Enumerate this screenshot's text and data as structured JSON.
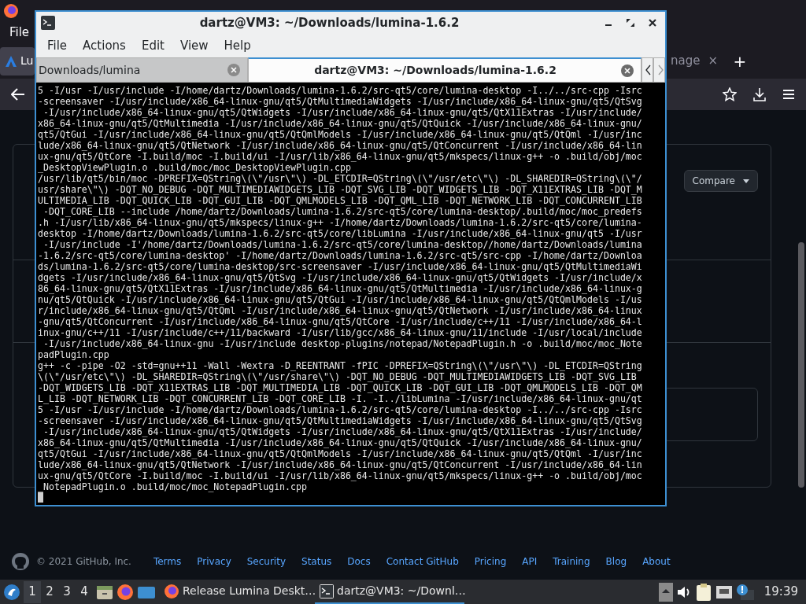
{
  "browser": {
    "menu": [
      "File"
    ],
    "tabs": [
      {
        "label": "Lu"
      },
      {
        "label": "nage"
      }
    ],
    "tab_close": "×",
    "new_tab": "+",
    "page": {
      "compare_button": "Compare",
      "footer": {
        "copyright": "© 2021 GitHub, Inc.",
        "links": [
          "Terms",
          "Privacy",
          "Security",
          "Status",
          "Docs",
          "Contact GitHub",
          "Pricing",
          "API",
          "Training",
          "Blog",
          "About"
        ]
      }
    }
  },
  "terminal": {
    "title": "dartz@VM3: ~/Downloads/lumina-1.6.2",
    "menu": [
      "File",
      "Actions",
      "Edit",
      "View",
      "Help"
    ],
    "tabs": [
      {
        "label": "Downloads/lumina",
        "selected": false
      },
      {
        "label": "dartz@VM3: ~/Downloads/lumina-1.6.2",
        "selected": true
      }
    ],
    "lines": [
      "5 -I/usr -I/usr/include -I/home/dartz/Downloads/lumina-1.6.2/src-qt5/core/lumina-desktop -I../../src-cpp -Isrc",
      "-screensaver -I/usr/include/x86_64-linux-gnu/qt5/QtMultimediaWidgets -I/usr/include/x86_64-linux-gnu/qt5/QtSvg",
      " -I/usr/include/x86_64-linux-gnu/qt5/QtWidgets -I/usr/include/x86_64-linux-gnu/qt5/QtX11Extras -I/usr/include/",
      "x86_64-linux-gnu/qt5/QtMultimedia -I/usr/include/x86_64-linux-gnu/qt5/QtQuick -I/usr/include/x86_64-linux-gnu/",
      "qt5/QtGui -I/usr/include/x86_64-linux-gnu/qt5/QtQmlModels -I/usr/include/x86_64-linux-gnu/qt5/QtQml -I/usr/inc",
      "lude/x86_64-linux-gnu/qt5/QtNetwork -I/usr/include/x86_64-linux-gnu/qt5/QtConcurrent -I/usr/include/x86_64-lin",
      "ux-gnu/qt5/QtCore -I.build/moc -I.build/ui -I/usr/lib/x86_64-linux-gnu/qt5/mkspecs/linux-g++ -o .build/obj/moc",
      "_DesktopViewPlugin.o .build/moc/moc_DesktopViewPlugin.cpp",
      "/usr/lib/qt5/bin/moc -DPREFIX=QString\\(\\\"/usr\\\"\\) -DL_ETCDIR=QString\\(\\\"/usr/etc\\\"\\) -DL_SHAREDIR=QString\\(\\\"/",
      "usr/share\\\"\\) -DQT_NO_DEBUG -DQT_MULTIMEDIAWIDGETS_LIB -DQT_SVG_LIB -DQT_WIDGETS_LIB -DQT_X11EXTRAS_LIB -DQT_M",
      "ULTIMEDIA_LIB -DQT_QUICK_LIB -DQT_GUI_LIB -DQT_QMLMODELS_LIB -DQT_QML_LIB -DQT_NETWORK_LIB -DQT_CONCURRENT_LIB",
      " -DQT_CORE_LIB --include /home/dartz/Downloads/lumina-1.6.2/src-qt5/core/lumina-desktop/.build/moc/moc_predefs",
      ".h -I/usr/lib/x86_64-linux-gnu/qt5/mkspecs/linux-g++ -I/home/dartz/Downloads/lumina-1.6.2/src-qt5/core/lumina-",
      "desktop -I/home/dartz/Downloads/lumina-1.6.2/src-qt5/core/libLumina -I/usr/include/x86_64-linux-gnu/qt5 -I/usr",
      " -I/usr/include -I'/home/dartz/Downloads/lumina-1.6.2/src-qt5/core/lumina-desktop//home/dartz/Downloads/lumina",
      "-1.6.2/src-qt5/core/lumina-desktop' -I/home/dartz/Downloads/lumina-1.6.2/src-qt5/src-cpp -I/home/dartz/Downloa",
      "ds/lumina-1.6.2/src-qt5/core/lumina-desktop/src-screensaver -I/usr/include/x86_64-linux-gnu/qt5/QtMultimediaWi",
      "dgets -I/usr/include/x86_64-linux-gnu/qt5/QtSvg -I/usr/include/x86_64-linux-gnu/qt5/QtWidgets -I/usr/include/x",
      "86_64-linux-gnu/qt5/QtX11Extras -I/usr/include/x86_64-linux-gnu/qt5/QtMultimedia -I/usr/include/x86_64-linux-g",
      "nu/qt5/QtQuick -I/usr/include/x86_64-linux-gnu/qt5/QtGui -I/usr/include/x86_64-linux-gnu/qt5/QtQmlModels -I/us",
      "r/include/x86_64-linux-gnu/qt5/QtQml -I/usr/include/x86_64-linux-gnu/qt5/QtNetwork -I/usr/include/x86_64-linux",
      "-gnu/qt5/QtConcurrent -I/usr/include/x86_64-linux-gnu/qt5/QtCore -I/usr/include/c++/11 -I/usr/include/x86_64-l",
      "inux-gnu/c++/11 -I/usr/include/c++/11/backward -I/usr/lib/gcc/x86_64-linux-gnu/11/include -I/usr/local/include",
      " -I/usr/include/x86_64-linux-gnu -I/usr/include desktop-plugins/notepad/NotepadPlugin.h -o .build/moc/moc_Note",
      "padPlugin.cpp",
      "g++ -c -pipe -O2 -std=gnu++11 -Wall -Wextra -D_REENTRANT -fPIC -DPREFIX=QString\\(\\\"/usr\\\"\\) -DL_ETCDIR=QString",
      "\\(\\\"/usr/etc\\\"\\) -DL_SHAREDIR=QString\\(\\\"/usr/share\\\"\\) -DQT_NO_DEBUG -DQT_MULTIMEDIAWIDGETS_LIB -DQT_SVG_LIB",
      "-DQT_WIDGETS_LIB -DQT_X11EXTRAS_LIB -DQT_MULTIMEDIA_LIB -DQT_QUICK_LIB -DQT_GUI_LIB -DQT_QMLMODELS_LIB -DQT_QM",
      "L_LIB -DQT_NETWORK_LIB -DQT_CONCURRENT_LIB -DQT_CORE_LIB -I. -I../libLumina -I/usr/include/x86_64-linux-gnu/qt",
      "5 -I/usr -I/usr/include -I/home/dartz/Downloads/lumina-1.6.2/src-qt5/core/lumina-desktop -I../../src-cpp -Isrc",
      "-screensaver -I/usr/include/x86_64-linux-gnu/qt5/QtMultimediaWidgets -I/usr/include/x86_64-linux-gnu/qt5/QtSvg",
      " -I/usr/include/x86_64-linux-gnu/qt5/QtWidgets -I/usr/include/x86_64-linux-gnu/qt5/QtX11Extras -I/usr/include/",
      "x86_64-linux-gnu/qt5/QtMultimedia -I/usr/include/x86_64-linux-gnu/qt5/QtQuick -I/usr/include/x86_64-linux-gnu/",
      "qt5/QtGui -I/usr/include/x86_64-linux-gnu/qt5/QtQmlModels -I/usr/include/x86_64-linux-gnu/qt5/QtQml -I/usr/inc",
      "lude/x86_64-linux-gnu/qt5/QtNetwork -I/usr/include/x86_64-linux-gnu/qt5/QtConcurrent -I/usr/include/x86_64-lin",
      "ux-gnu/qt5/QtCore -I.build/moc -I.build/ui -I/usr/lib/x86_64-linux-gnu/qt5/mkspecs/linux-g++ -o .build/obj/moc",
      "_NotepadPlugin.o .build/moc/moc_NotepadPlugin.cpp"
    ]
  },
  "taskbar": {
    "workspaces": [
      {
        "label": "1",
        "selected": true
      },
      {
        "label": "2",
        "selected": false
      },
      {
        "label": "3",
        "selected": false
      },
      {
        "label": "4",
        "selected": false
      }
    ],
    "tasks": [
      {
        "kind": "browser",
        "label": "Release Lumina Deskt…",
        "selected": false
      },
      {
        "kind": "terminal",
        "label": "dartz@VM3: ~/Downl…",
        "selected": true
      }
    ],
    "clock": "19:39"
  }
}
